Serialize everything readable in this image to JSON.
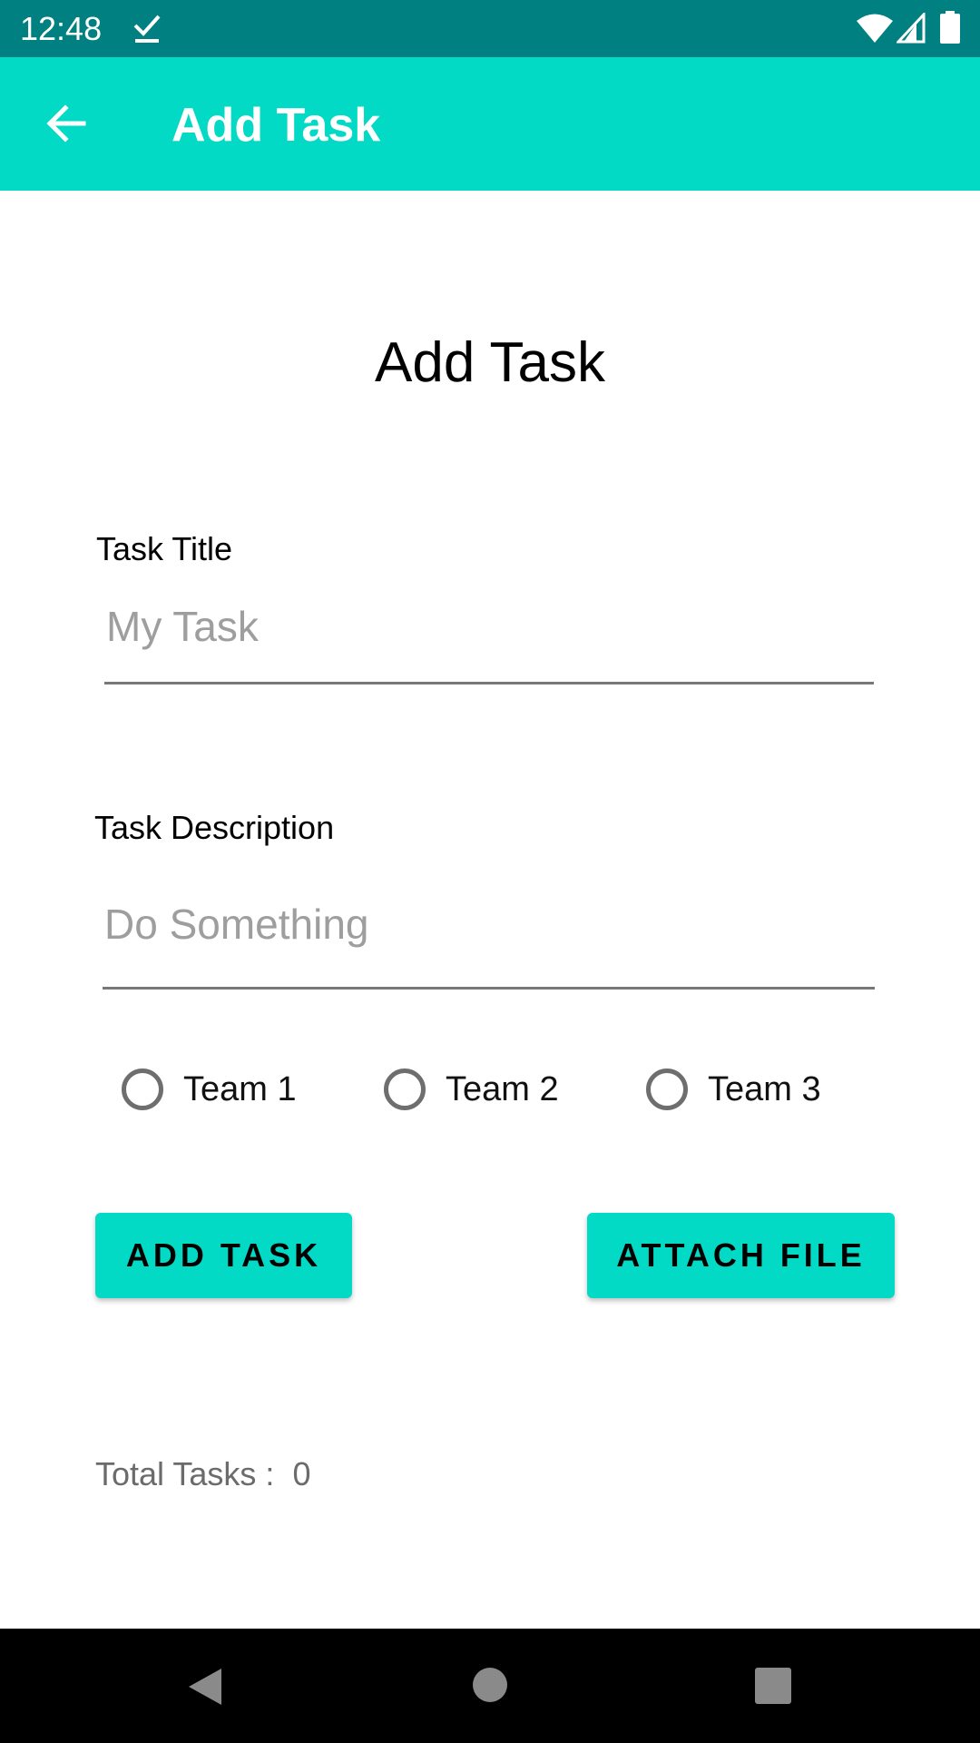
{
  "status_bar": {
    "time": "12:48"
  },
  "app_bar": {
    "title": "Add Task"
  },
  "page": {
    "heading": "Add Task"
  },
  "form": {
    "title_label": "Task Title",
    "title_placeholder": "My Task",
    "title_value": "",
    "description_label": "Task Description",
    "description_placeholder": "Do Something",
    "description_value": ""
  },
  "teams": [
    {
      "label": "Team 1",
      "selected": false
    },
    {
      "label": "Team 2",
      "selected": false
    },
    {
      "label": "Team 3",
      "selected": false
    }
  ],
  "buttons": {
    "add_task": "ADD TASK",
    "attach_file": "ATTACH FILE"
  },
  "summary": {
    "total_tasks_label": "Total Tasks :",
    "total_tasks_value": "0"
  },
  "colors": {
    "status_bar": "#008080",
    "accent": "#03dac5",
    "nav_bar": "#000000"
  },
  "icons": {
    "back": "arrow-back-icon",
    "check": "check-icon",
    "wifi": "wifi-icon",
    "signal": "signal-icon",
    "battery": "battery-icon",
    "nav_back": "nav-back-icon",
    "nav_home": "nav-home-icon",
    "nav_recent": "nav-recent-icon"
  }
}
